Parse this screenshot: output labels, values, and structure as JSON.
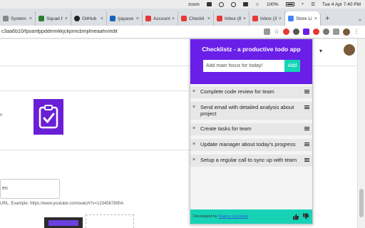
{
  "menubar": {
    "app": "zoom",
    "battery": "100%",
    "datetime": "Tue 4 Apr  7:40 PM"
  },
  "tabs": [
    {
      "label": "System F",
      "color": "#888888"
    },
    {
      "label": "Squad h",
      "color": "#2e7d32"
    },
    {
      "label": "GitHub",
      "color": "#222222"
    },
    {
      "label": "rjayasw",
      "color": "#1565c0"
    },
    {
      "label": "Account",
      "color": "#e53935"
    },
    {
      "label": "Checkli",
      "color": "#e53935"
    },
    {
      "label": "Inbox (8",
      "color": "#e53935"
    },
    {
      "label": "Inbox (3",
      "color": "#e53935"
    },
    {
      "label": "Store Li",
      "color": "#4285f4",
      "active": true
    }
  ],
  "newtab_label": "+",
  "tab_menu": "⌄",
  "address": {
    "url": "c3aa6b10/fpoanfppddmmkkjckjomcbmjilmeaahn/edit"
  },
  "page": {
    "chevron": "▾",
    "small_n": "n",
    "input_value": "eo",
    "url_hint": "URL. Example: https://www.youtube.com/watch?v=1234567890A"
  },
  "popup": {
    "title": "Checklistz - a productive todo app",
    "focus_placeholder": "Add main focus for today!",
    "add_label": "Add",
    "remove_glyph": "×",
    "tasks": [
      "Complete code review for team",
      "Send email with detailed analysis about project",
      "Create tasks for team",
      "Update manager about today's progress",
      "Setup a regular call to sync up with team"
    ],
    "footer_prefix": "Developed by",
    "footer_author": "Rajeev Jayaswal"
  },
  "colors": {
    "header": "#6a1fe8",
    "accent": "#17d3b6"
  }
}
